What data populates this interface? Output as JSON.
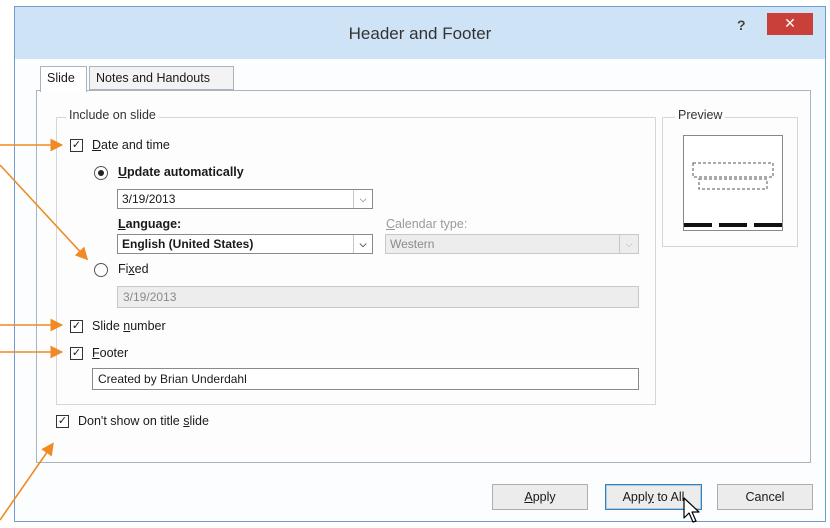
{
  "window": {
    "title": "Header and Footer",
    "help_label": "?",
    "close_label": "✕"
  },
  "tabs": [
    {
      "label": "Slide",
      "active": true
    },
    {
      "label": "Notes and Handouts",
      "active": false
    }
  ],
  "include_group": {
    "legend": "Include on slide",
    "date_time": {
      "label_prefix": "D",
      "label_rest": "ate and time",
      "checked": true,
      "update_auto": {
        "label_prefix": "U",
        "label_rest": "pdate automatically",
        "selected": true
      },
      "date_value": "3/19/2013",
      "language": {
        "label_prefix": "L",
        "label_rest": "anguage:",
        "value": "English (United States)"
      },
      "calendar": {
        "label_prefix": "C",
        "label_rest": "alendar type:",
        "value": "Western"
      },
      "fixed": {
        "label_pre": "Fi",
        "label_key": "x",
        "label_post": "ed",
        "selected": false,
        "value": "3/19/2013"
      }
    },
    "slide_number": {
      "label_pre": "Slide ",
      "label_key": "n",
      "label_post": "umber",
      "checked": true
    },
    "footer": {
      "label_prefix": "F",
      "label_rest": "ooter",
      "checked": true,
      "value": "Created by Brian Underdahl"
    }
  },
  "dont_show_title": {
    "label_pre": "Don't show on title ",
    "label_key": "s",
    "label_post": "lide",
    "checked": true
  },
  "preview": {
    "legend": "Preview"
  },
  "buttons": {
    "apply": {
      "pre": "",
      "key": "A",
      "post": "pply"
    },
    "apply_all": {
      "pre": "Appl",
      "key": "y",
      "post": " to All"
    },
    "cancel": {
      "label": "Cancel"
    }
  },
  "annotation_color": "#f08a24"
}
